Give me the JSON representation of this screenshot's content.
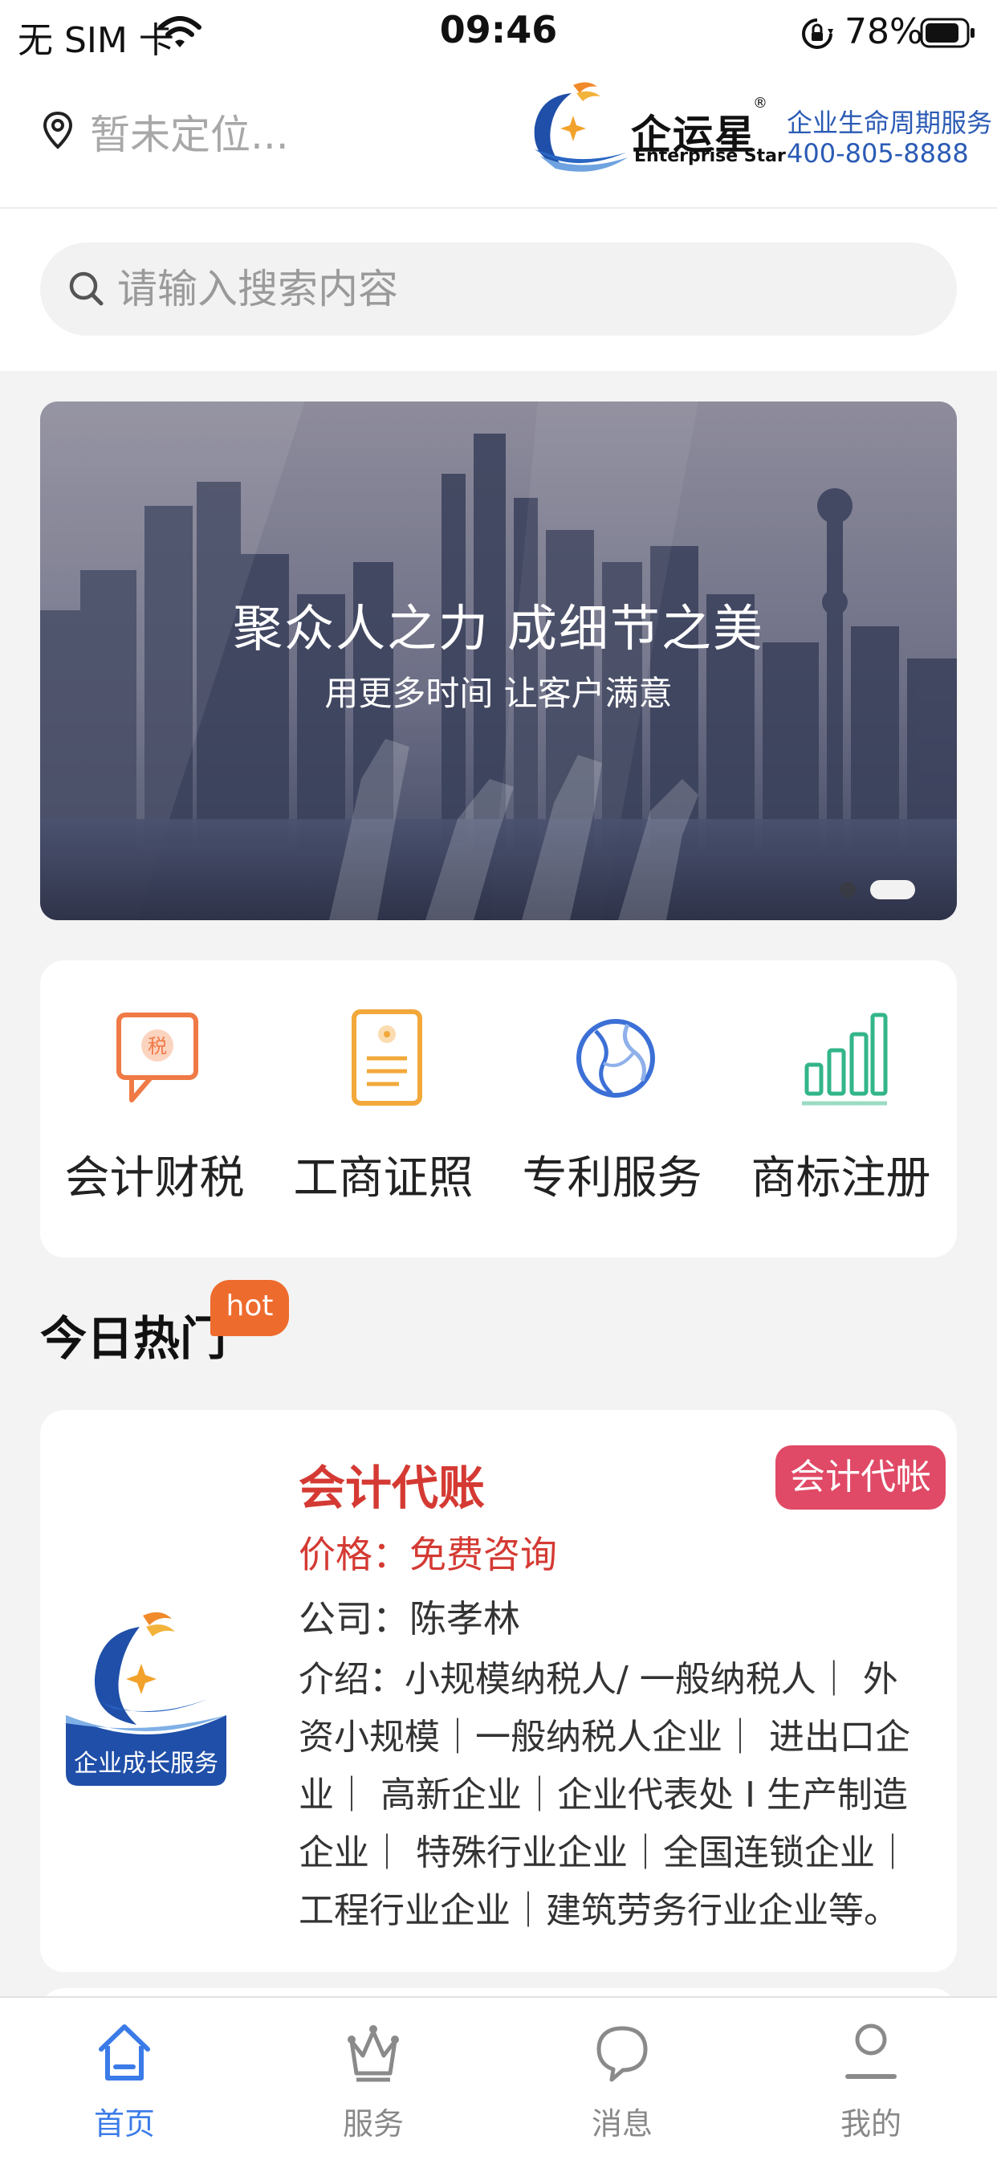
{
  "status_bar": {
    "carrier": "无 SIM 卡",
    "time": "09:46",
    "battery": "78%"
  },
  "header": {
    "location": "暂未定位...",
    "brand_name": "企运星",
    "brand_sub": "Enterprise Star",
    "brand_mark": "®",
    "slogan": "企业生命周期服务",
    "phone": "400-805-8888"
  },
  "search": {
    "placeholder": "请输入搜索内容"
  },
  "banner": {
    "title": "聚众人之力 成细节之美",
    "subtitle": "用更多时间  让客户满意"
  },
  "categories": [
    {
      "label": "会计财税",
      "icon": "tax-chat-icon",
      "color": "#f07a46",
      "icon_text": "税"
    },
    {
      "label": "工商证照",
      "icon": "license-icon",
      "color": "#f2a83a"
    },
    {
      "label": "专利服务",
      "icon": "globe-icon",
      "color": "#3c70d6"
    },
    {
      "label": "商标注册",
      "icon": "bar-chart-icon",
      "color": "#33b58a"
    }
  ],
  "hot": {
    "title": "今日热门",
    "badge": "hot"
  },
  "card": {
    "title": "会计代账",
    "tag": "会计代帐",
    "price": "价格：免费咨询",
    "company": "公司：陈孝林",
    "intro": "介绍：小规模纳税人/ 一般纳税人｜ 外资小规模｜一般纳税人企业｜ 进出口企业｜ 高新企业｜企业代表处 I 生产制造企业｜ 特殊行业企业｜全国连锁企业｜工程行业企业｜建筑劳务行业企业等。",
    "logo_text": "企业成长服务"
  },
  "tabs": [
    {
      "label": "首页",
      "icon": "home-icon",
      "active": true
    },
    {
      "label": "服务",
      "icon": "crown-icon",
      "active": false
    },
    {
      "label": "消息",
      "icon": "chat-bubble-icon",
      "active": false
    },
    {
      "label": "我的",
      "icon": "user-icon",
      "active": false
    }
  ],
  "colors": {
    "accent": "#3b7be8",
    "price_red": "#d43a33",
    "hot_orange": "#ee6b2e",
    "tag_pink": "#e04a66",
    "brand_blue": "#2b5bb5"
  }
}
